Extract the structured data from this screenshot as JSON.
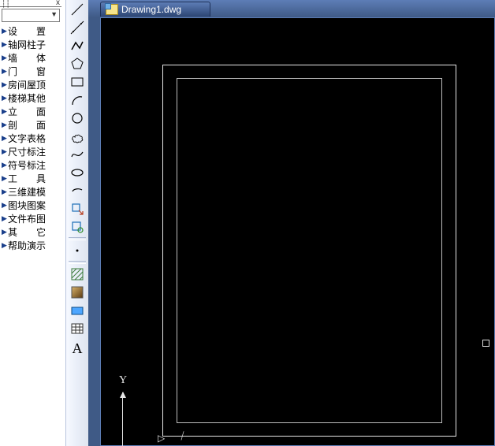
{
  "panel": {
    "close_glyph": "x",
    "items": [
      "设　　置",
      "轴网柱子",
      "墙　　体",
      "门　　窗",
      "房间屋顶",
      "楼梯其他",
      "立　　面",
      "剖　　面",
      "文字表格",
      "尺寸标注",
      "符号标注",
      "工　　具",
      "三维建模",
      "图块图案",
      "文件布图",
      "其　　它",
      "帮助演示"
    ]
  },
  "toolbar": {
    "text_tool_label": "A"
  },
  "document": {
    "tab_title": "Drawing1.dwg",
    "axis_y_label": "Y"
  }
}
